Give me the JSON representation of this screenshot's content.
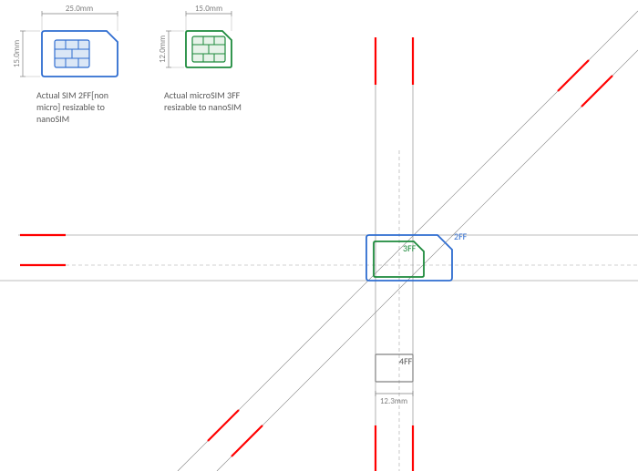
{
  "colors": {
    "sim2ff": "#2f6dd0",
    "microsim3ff": "#1d8a3c",
    "guide_red": "#ff0000",
    "guide_grey": "#7f7f7f",
    "dash_grey": "#a6a6a6",
    "chip_fill_2ff": "#dbe7f6",
    "chip_fill_3ff": "#e7f3e9",
    "nano_grey": "#808080"
  },
  "dims": {
    "sim2ff_w": "25.0mm",
    "sim2ff_h": "15.0mm",
    "microsim_w": "15.0mm",
    "microsim_h": "12.0mm",
    "nano_w": "12.3mm"
  },
  "labels": {
    "sim2ff_caption_l1": "Actual SIM 2FF[non",
    "sim2ff_caption_l2": "micro] resizable to",
    "sim2ff_caption_l3": "nanoSIM",
    "microsim_caption_l1": "Actual microSIM 3FF",
    "microsim_caption_l2": "resizable to nanoSIM",
    "tag_2ff": "2FF",
    "tag_3ff": "3FF",
    "tag_4ff": "4FF"
  }
}
